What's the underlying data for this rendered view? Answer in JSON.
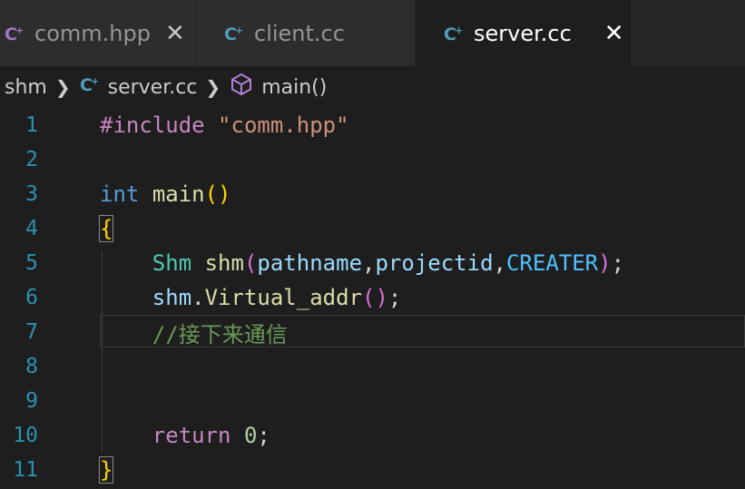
{
  "tabs": [
    {
      "label": "comm.hpp",
      "icon": "cpp-file-icon",
      "close": "✕",
      "active": false
    },
    {
      "label": "client.cc",
      "icon": "cpp-file-icon",
      "active": false
    },
    {
      "label": "server.cc",
      "icon": "cpp-file-icon",
      "close": "✕",
      "active": true
    }
  ],
  "breadcrumb": {
    "folder": "shm",
    "file": "server.cc",
    "symbol": "main()"
  },
  "colors": {
    "accent_cpp_icon": "#a074c4",
    "line_number": "#858585",
    "line_number_active": "#c6c6c6"
  },
  "editor": {
    "lines": [
      {
        "num": "1"
      },
      {
        "num": "2"
      },
      {
        "num": "3"
      },
      {
        "num": "4"
      },
      {
        "num": "5"
      },
      {
        "num": "6"
      },
      {
        "num": "7"
      },
      {
        "num": "8"
      },
      {
        "num": "9"
      },
      {
        "num": "10"
      },
      {
        "num": "11"
      }
    ],
    "tokens": {
      "l1_directive": "#include ",
      "l1_header": "\"comm.hpp\"",
      "l3_type": "int",
      "l3_space": " ",
      "l3_func": "main",
      "l3_parens": "()",
      "l4_brace": "{",
      "l5_indent": "    ",
      "l5_class": "Shm",
      "l5_space": " ",
      "l5_var": "shm",
      "l5_open": "(",
      "l5_arg1": "pathname",
      "l5_comma1": ",",
      "l5_arg2": "projectid",
      "l5_comma2": ",",
      "l5_arg3": "CREATER",
      "l5_close": ")",
      "l5_semi": ";",
      "l6_indent": "    ",
      "l6_obj": "shm",
      "l6_dot": ".",
      "l6_method": "Virtual_addr",
      "l6_parens": "()",
      "l6_semi": ";",
      "l7_indent": "    ",
      "l7_comment": "//接下来通信",
      "l10_indent": "    ",
      "l10_kw": "return",
      "l10_space": " ",
      "l10_num": "0",
      "l10_semi": ";",
      "l11_brace": "}"
    }
  }
}
